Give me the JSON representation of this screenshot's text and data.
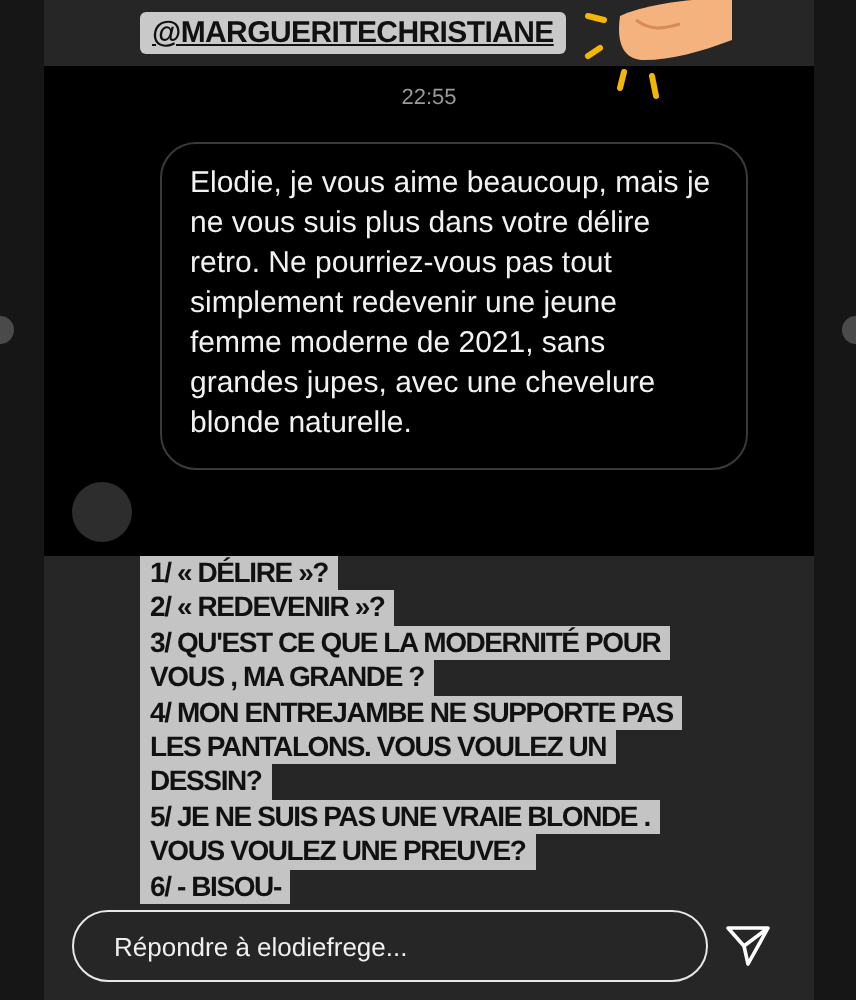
{
  "story": {
    "mention": "@MARGUERITECHRISTIANE",
    "screenshot": {
      "time": "22:55",
      "message": "Elodie, je vous aime beaucoup, mais je ne vous suis plus dans votre délire retro. Ne pourriez-vous pas tout simplement redevenir une jeune femme moderne de 2021, sans grandes jupes, avec une chevelure blonde naturelle."
    },
    "reply_lines": [
      "1/ « DÉLIRE »?",
      "2/ « REDEVENIR »?",
      "3/ QU'EST CE QUE LA MODERNITÉ POUR",
      "VOUS , MA GRANDE ?",
      "4/ MON ENTREJAMBE NE SUPPORTE PAS",
      "LES PANTALONS. VOUS VOULEZ UN",
      "DESSIN?",
      "5/ JE NE SUIS PAS UNE VRAIE BLONDE .",
      "VOUS VOULEZ UNE PREUVE?",
      "6/ - BISOU-"
    ]
  },
  "reply_field": {
    "placeholder": "Répondre à elodiefrege..."
  }
}
